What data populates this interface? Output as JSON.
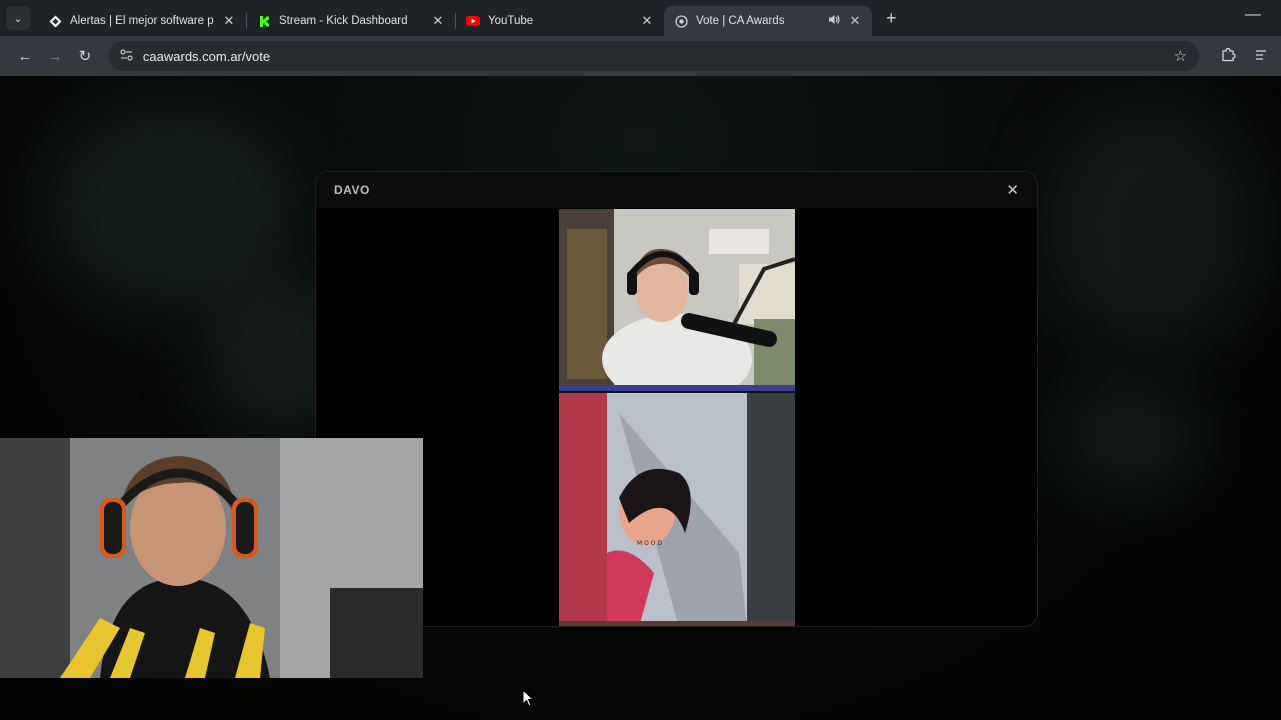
{
  "tabs": [
    {
      "label": "Alertas | El mejor software para",
      "icon": "diamond-icon",
      "close": "✕"
    },
    {
      "label": "Stream - Kick Dashboard",
      "icon": "kick-icon",
      "close": "✕"
    },
    {
      "label": "YouTube",
      "icon": "youtube-icon",
      "close": "✕"
    },
    {
      "label": "Vote | CA Awards",
      "icon": "award-icon",
      "close": "✕",
      "sound": "🔊"
    }
  ],
  "new_tab": "+",
  "minimize": "—",
  "address_bar": {
    "url": "caawards.com.ar/vote"
  },
  "modal": {
    "title": "DAVO",
    "close": "✕"
  },
  "video_overlay_text": "M O O D",
  "colors": {
    "kick_green": "#53fc18",
    "youtube_red": "#ff0000",
    "chrome_dark": "#1f2226",
    "toolbar": "#35393f"
  }
}
